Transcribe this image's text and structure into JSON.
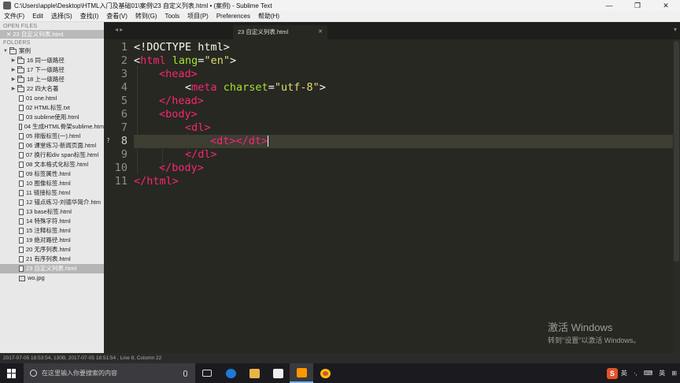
{
  "window": {
    "title": "C:\\Users\\apple\\Desktop\\HTML入门及基础01\\案例\\23 自定义列表.html • (案例) - Sublime Text",
    "minimize": "—",
    "restore": "❐",
    "close": "✕"
  },
  "menu": [
    "文件(F)",
    "Edit",
    "选择(S)",
    "查找(I)",
    "查看(V)",
    "转到(G)",
    "Tools",
    "项目(P)",
    "Preferences",
    "帮助(H)"
  ],
  "sidebar": {
    "open_files_header": "OPEN FILES",
    "open_file": "✕ 23 自定义列表.html",
    "folders_header": "FOLDERS",
    "root_folder": "案例",
    "subfolders": [
      "16 同一级路径",
      "17 下一级路径",
      "18 上一级路径",
      "22 四大名著"
    ],
    "files": [
      "01 one.html",
      "02 HTML标签.txt",
      "03 sublime使用.html",
      "04 生成HTML骨架sublime.htm",
      "05 排版标签(一).html",
      "06 课堂练习-新闻页面.html",
      "07 换行和div span标签.html",
      "08 文本格式化标签.html",
      "09 标签属性.html",
      "10 图像标签.html",
      "11 链接标签.html",
      "12 锚点练习-刘德华简介.htm",
      "13 base标签.html",
      "14 特殊字符.html",
      "15 注释标签.html",
      "19 绝对路径.html",
      "20 无序列表.html",
      "21 有序列表.html",
      "23 自定义列表.html",
      "wo.jpg"
    ],
    "selected_file": "23 自定义列表.html"
  },
  "tabbar": {
    "nav": "◂ ▸",
    "active_tab": "23 自定义列表.html",
    "close": "✕",
    "dropdown": "▾"
  },
  "editor": {
    "line_numbers": [
      "1",
      "2",
      "3",
      "4",
      "5",
      "6",
      "7",
      "8",
      "9",
      "10",
      "11"
    ],
    "current_line": "8",
    "gutter_mark": "?",
    "code": {
      "l1": "<!DOCTYPE html>",
      "l2_open": "<",
      "l2_tag": "html",
      "l2_attr": " lang",
      "l2_eq": "=",
      "l2_val": "\"en\"",
      "l2_close": ">",
      "l3": "<head>",
      "l4_open": "<",
      "l4_tag": "meta",
      "l4_attr": " charset",
      "l4_eq": "=",
      "l4_val": "\"utf-8\"",
      "l4_close": ">",
      "l5": "</head>",
      "l6": "<body>",
      "l7": "<dl>",
      "l8_a": "<dt>",
      "l8_b": "</dt>",
      "l9": "</dl>",
      "l10": "</body>",
      "l11": "</html>"
    }
  },
  "watermark": {
    "line1": "激活 Windows",
    "line2": "转到\"设置\"以激活 Windows。"
  },
  "statusbar": {
    "text": "2017-07-05 18:53:54, 130B, 2017-07-05 18:51:54 , Line 8, Column 22"
  },
  "taskbar": {
    "search_placeholder": "在这里输入你要搜索的内容",
    "tray": {
      "ime_logo": "S",
      "ime_lang": "英",
      "punct": "·,",
      "extra": "⌨",
      "lang": "英",
      "apps": "⊞"
    }
  },
  "colors": {
    "editor_bg": "#272822",
    "tag": "#f92672",
    "attr": "#a6e22e",
    "string": "#e6db74",
    "text": "#f8f8f2"
  }
}
